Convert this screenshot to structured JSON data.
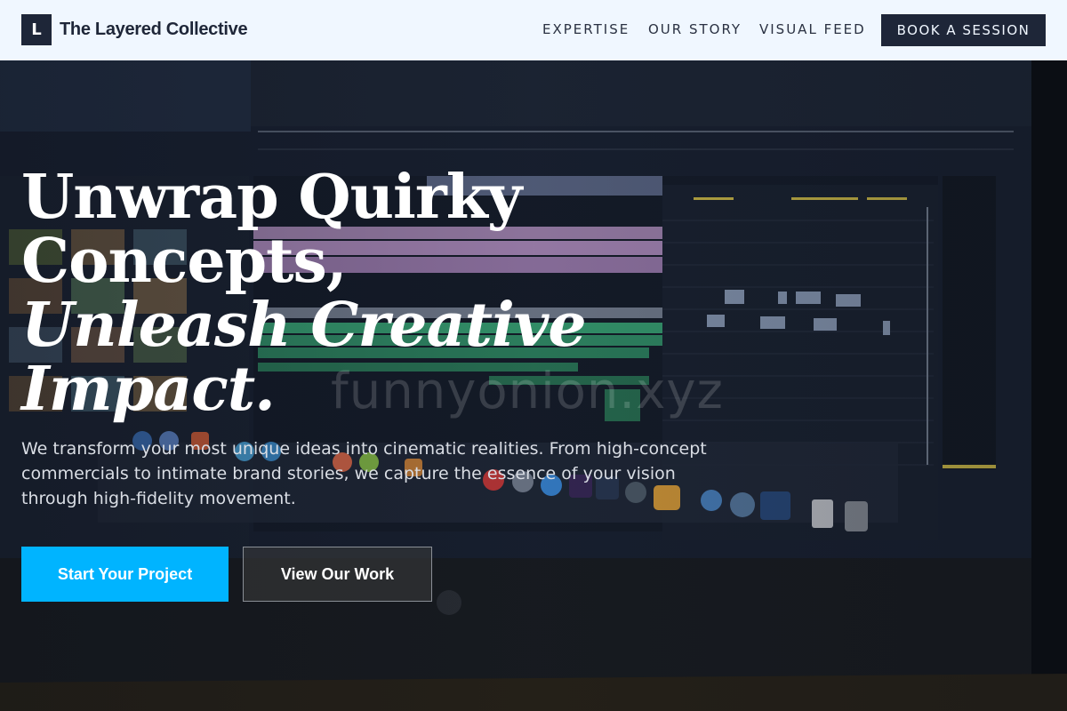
{
  "brand": {
    "logo_letter": "L",
    "name": "The Layered Collective"
  },
  "nav": {
    "items": [
      {
        "label": "EXPERTISE"
      },
      {
        "label": "OUR STORY"
      },
      {
        "label": "VISUAL FEED"
      }
    ],
    "cta_label": "BOOK A SESSION"
  },
  "hero": {
    "headline_lines": [
      "Unwrap Quirky",
      "Concepts,",
      "Unleash Creative",
      "Impact."
    ],
    "lede": "We transform your most unique ideas into cinematic realities. From high-concept commercials to intimate brand stories, we capture the essence of your vision through high-fidelity movement.",
    "primary_label": "Start Your Project",
    "secondary_label": "View Our Work",
    "watermark": "funnyonion.xyz"
  },
  "colors": {
    "header_bg": "#f0f7ff",
    "dark_navy": "#1e2638",
    "accent_cyan": "#00b4ff",
    "hero_bg": "#0e1522"
  },
  "icons": {
    "logo": "letter-mark-icon"
  }
}
